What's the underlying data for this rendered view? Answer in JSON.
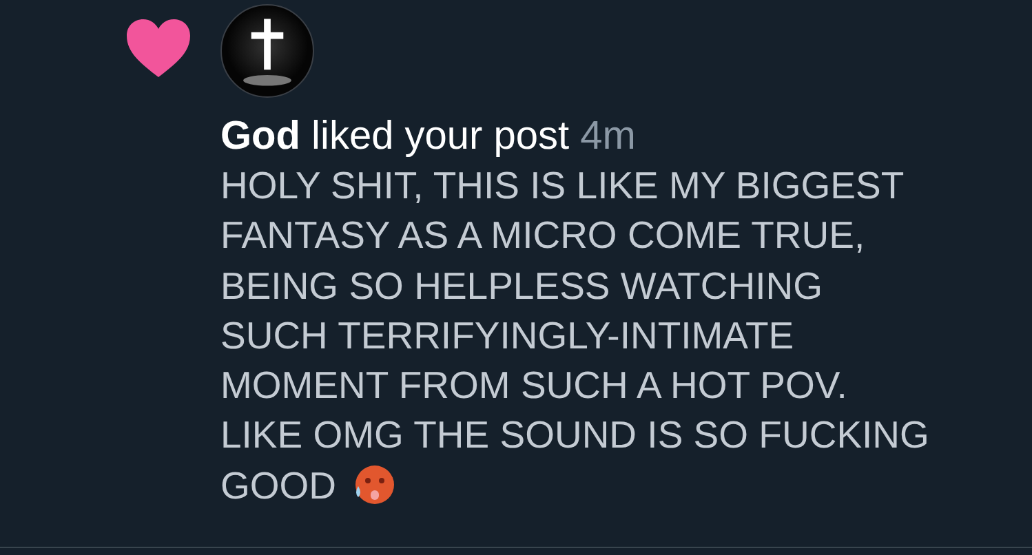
{
  "notification": {
    "liked": true,
    "actor_line": "**God** liked your post",
    "time": "4m",
    "post_lines": [
      "HOLY SHIT, THIS IS LIKE MY BIGGEST",
      "FANTASY AS A MICRO COME TRUE,",
      "BEING SO HELPLESS WATCHING",
      "SUCH TERRIFYINGLY-INTIMATE",
      "MOMENT FROM SUCH A HOT POV.",
      "LIKE OMG THE SOUND IS SO FUCKING",
      "GOOD"
    ]
  }
}
